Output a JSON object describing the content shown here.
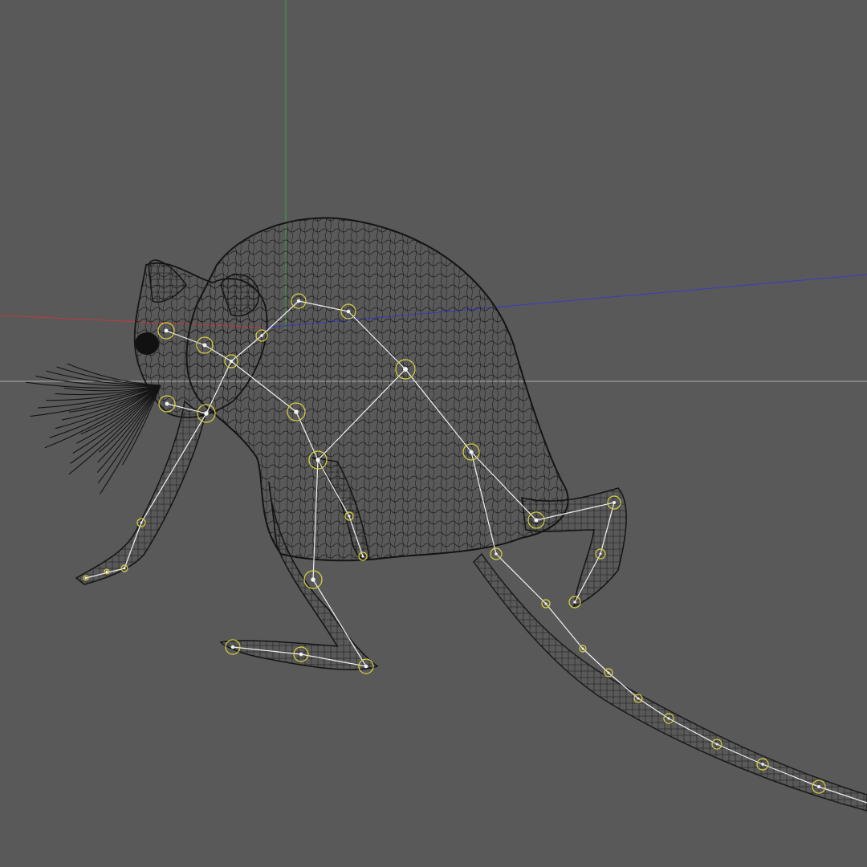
{
  "viewport": {
    "background": "#595959",
    "axis_colors": {
      "x": "#c03a3a",
      "y": "#3aa63a",
      "z": "#3a3ac8",
      "horizon": "#b0b0b0"
    },
    "mesh_color": "#161616",
    "bone_color": "#f2f2f2",
    "joint_color": "#d9d240"
  },
  "model": {
    "subject": "rat-wireframe-rig",
    "icon": "rat-model-icon"
  }
}
